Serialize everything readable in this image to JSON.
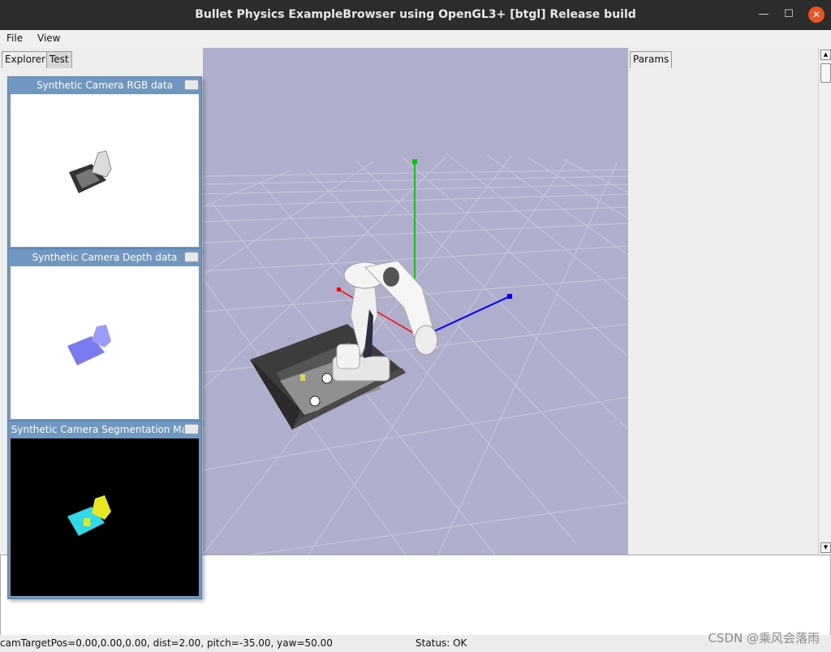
{
  "window": {
    "title": "Bullet Physics ExampleBrowser using OpenGL3+ [btgl] Release build"
  },
  "menu": {
    "file": "File",
    "view": "View"
  },
  "tabs": {
    "explorer": "Explorer",
    "test": "Test",
    "params": "Params"
  },
  "windows": {
    "rgb": {
      "title": "Synthetic Camera RGB data"
    },
    "depth": {
      "title": "Synthetic Camera Depth data"
    },
    "seg": {
      "title": "Synthetic Camera Segmentation Mask"
    }
  },
  "status": {
    "camera": "camTargetPos=0.00,0.00,0.00, dist=2.00, pitch=-35.00, yaw=50.00",
    "state": "Status: OK"
  },
  "watermark": "CSDN @乘风会落雨",
  "colors": {
    "viewport_bg": "#afafcd",
    "axis_x": "#ff0000",
    "axis_y": "#00cc00",
    "axis_z": "#0000ff",
    "window_title_bg": "#6f97c0",
    "close_button": "#e95420"
  }
}
